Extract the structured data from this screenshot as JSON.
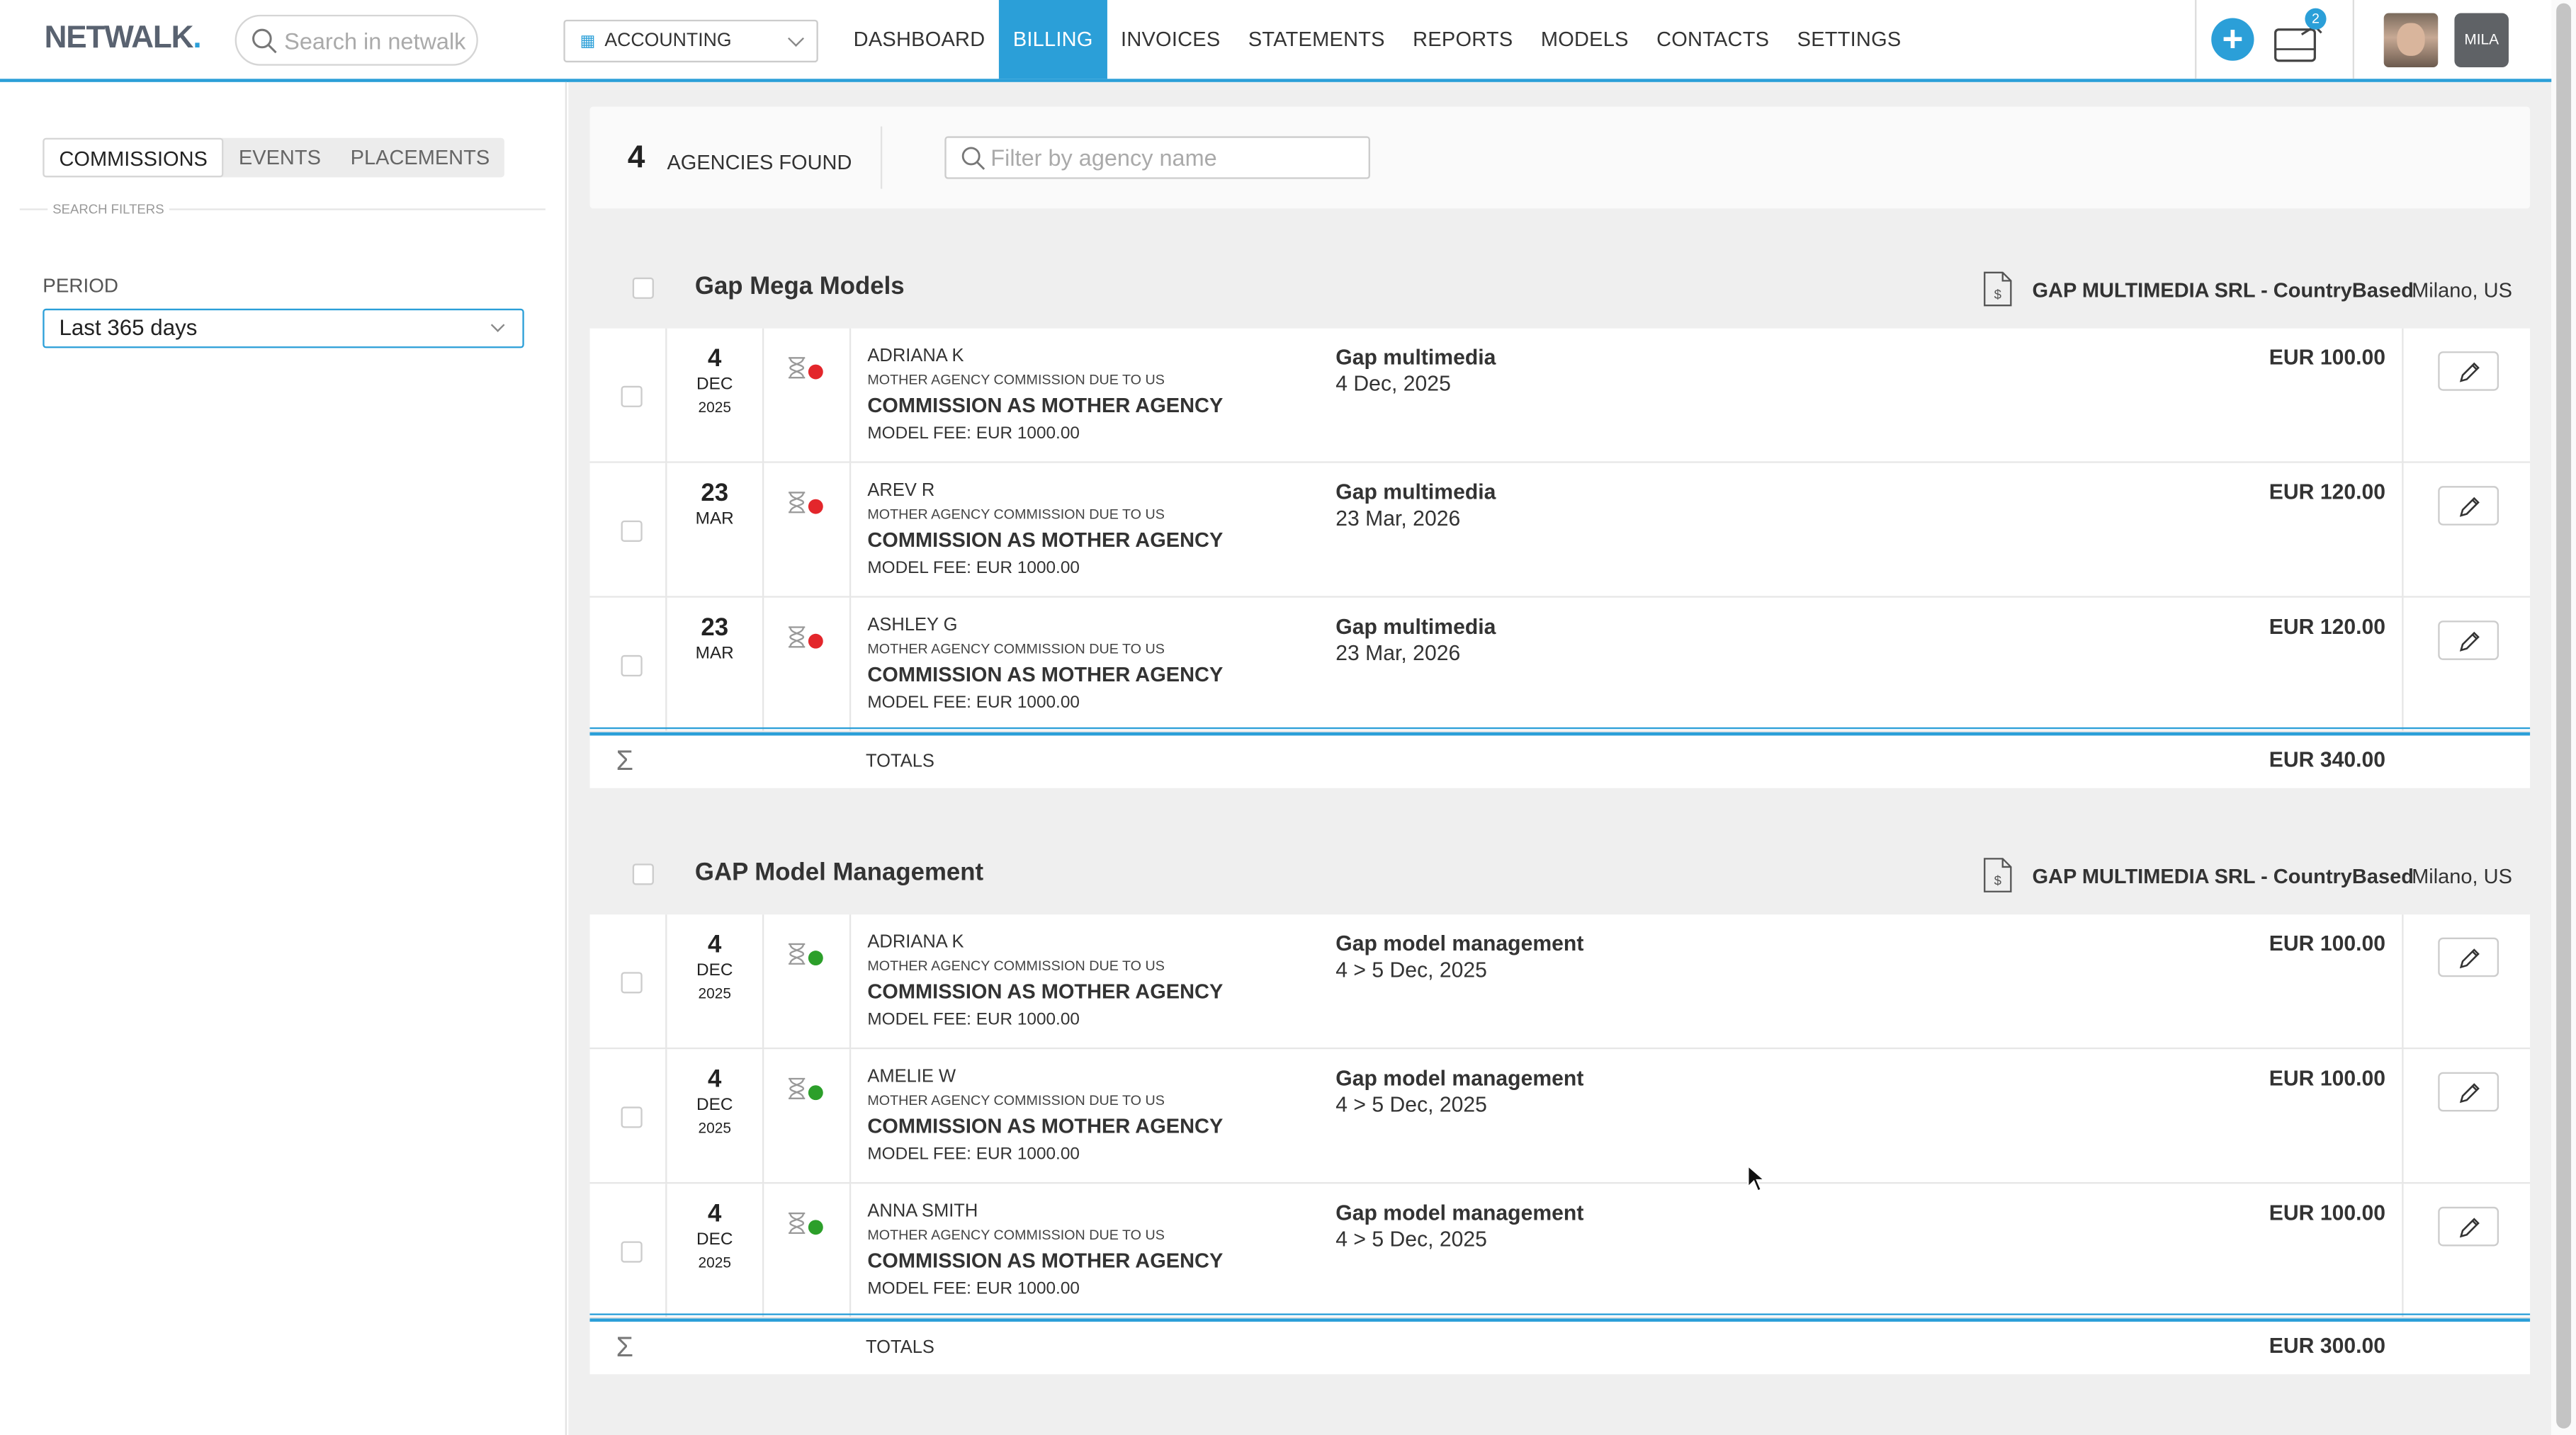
{
  "header": {
    "logo_text": "NETWALK",
    "logo_dot": ".",
    "search_placeholder": "Search in netwalk",
    "department": "ACCOUNTING",
    "nav": [
      "DASHBOARD",
      "BILLING",
      "INVOICES",
      "STATEMENTS",
      "REPORTS",
      "MODELS",
      "CONTACTS",
      "SETTINGS"
    ],
    "active_nav": "BILLING",
    "add_icon": "plus-icon",
    "notification_count": "2",
    "user_initials": "MILA"
  },
  "sidebar": {
    "tabs": [
      "COMMISSIONS",
      "EVENTS",
      "PLACEMENTS"
    ],
    "active_tab": "COMMISSIONS",
    "filters_label": "SEARCH FILTERS",
    "period_label": "PERIOD",
    "period_value": "Last 365 days"
  },
  "main": {
    "count": "4",
    "count_label": "AGENCIES FOUND",
    "filter_placeholder": "Filter by agency name",
    "groups": [
      {
        "name": "Gap Mega Models",
        "company": "GAP MULTIMEDIA SRL - CountryBased",
        "city": "Milano, US",
        "rows": [
          {
            "day": "4",
            "month": "DEC",
            "year": "2025",
            "status": "red",
            "model": "ADRIANA K",
            "subtitle": "MOTHER AGENCY COMMISSION DUE TO US",
            "type": "COMMISSION AS MOTHER AGENCY",
            "fee": "MODEL FEE: EUR 1000.00",
            "job": "Gap multimedia",
            "date": "4 Dec, 2025",
            "amount": "EUR 100.00"
          },
          {
            "day": "23",
            "month": "MAR",
            "year": "",
            "status": "red",
            "model": "AREV R",
            "subtitle": "MOTHER AGENCY COMMISSION DUE TO US",
            "type": "COMMISSION AS MOTHER AGENCY",
            "fee": "MODEL FEE: EUR 1000.00",
            "job": "Gap multimedia",
            "date": "23 Mar, 2026",
            "amount": "EUR 120.00"
          },
          {
            "day": "23",
            "month": "MAR",
            "year": "",
            "status": "red",
            "model": "ASHLEY G",
            "subtitle": "MOTHER AGENCY COMMISSION DUE TO US",
            "type": "COMMISSION AS MOTHER AGENCY",
            "fee": "MODEL FEE: EUR 1000.00",
            "job": "Gap multimedia",
            "date": "23 Mar, 2026",
            "amount": "EUR 120.00"
          }
        ],
        "totals_label": "TOTALS",
        "total": "EUR 340.00"
      },
      {
        "name": "GAP Model Management",
        "company": "GAP MULTIMEDIA SRL - CountryBased",
        "city": "Milano, US",
        "rows": [
          {
            "day": "4",
            "month": "DEC",
            "year": "2025",
            "status": "green",
            "model": "ADRIANA K",
            "subtitle": "MOTHER AGENCY COMMISSION DUE TO US",
            "type": "COMMISSION AS MOTHER AGENCY",
            "fee": "MODEL FEE: EUR 1000.00",
            "job": "Gap model management",
            "date": "4 > 5 Dec, 2025",
            "amount": "EUR 100.00"
          },
          {
            "day": "4",
            "month": "DEC",
            "year": "2025",
            "status": "green",
            "model": "AMELIE W",
            "subtitle": "MOTHER AGENCY COMMISSION DUE TO US",
            "type": "COMMISSION AS MOTHER AGENCY",
            "fee": "MODEL FEE: EUR 1000.00",
            "job": "Gap model management",
            "date": "4 > 5 Dec, 2025",
            "amount": "EUR 100.00"
          },
          {
            "day": "4",
            "month": "DEC",
            "year": "2025",
            "status": "green",
            "model": "ANNA SMITH",
            "subtitle": "MOTHER AGENCY COMMISSION DUE TO US",
            "type": "COMMISSION AS MOTHER AGENCY",
            "fee": "MODEL FEE: EUR 1000.00",
            "job": "Gap model management",
            "date": "4 > 5 Dec, 2025",
            "amount": "EUR 100.00"
          }
        ],
        "totals_label": "TOTALS",
        "total": "EUR 300.00"
      }
    ]
  },
  "colors": {
    "accent": "#2b9fd8",
    "status_red": "#e3262b",
    "status_green": "#2c9f2a"
  }
}
